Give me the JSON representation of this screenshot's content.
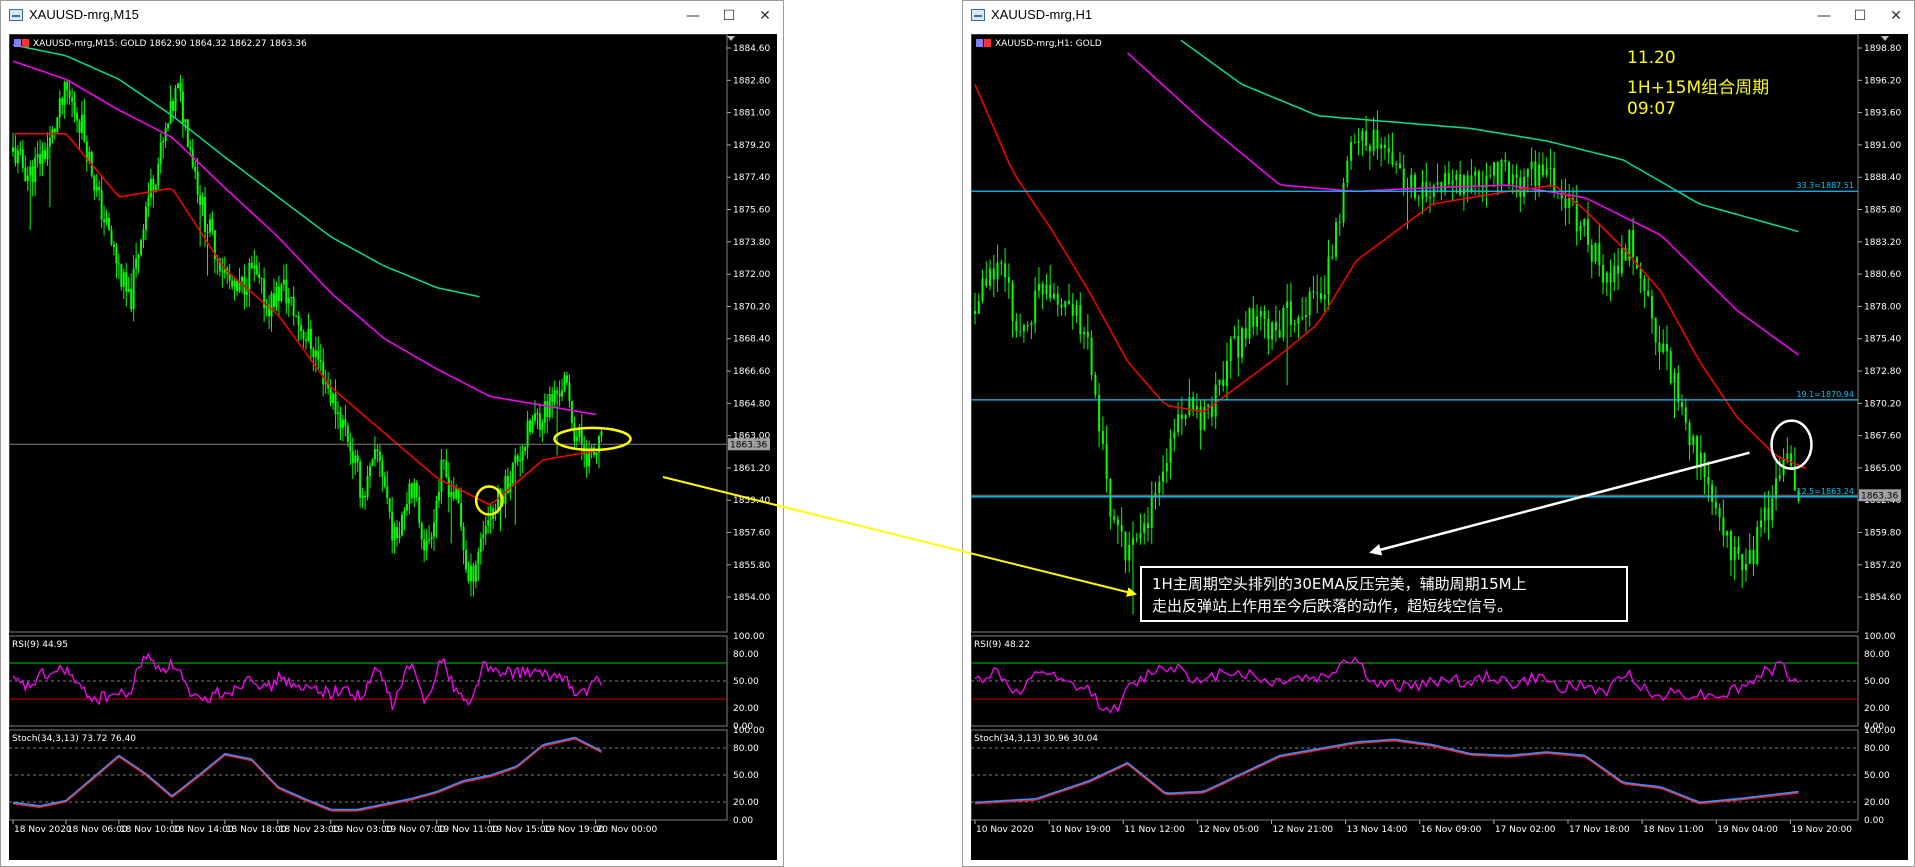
{
  "windows": [
    {
      "id": "m15",
      "title": "XAUUSD-mrg,M15",
      "info_line": "XAUUSD-mrg,M15:  GOLD   1862.90 1864.32 1862.27 1863.36",
      "price_axis": [
        "1884.60",
        "1882.80",
        "1881.00",
        "1879.20",
        "1877.40",
        "1875.60",
        "1873.80",
        "1872.00",
        "1870.20",
        "1868.40",
        "1866.60",
        "1864.80",
        "1863.00",
        "1861.20",
        "1859.40",
        "1857.60",
        "1855.80",
        "1854.00"
      ],
      "current_price": "1863.36",
      "rsi_label": "RSI(9) 44.95",
      "rsi_axis": [
        "100.00",
        "80.00",
        "50.00",
        "20.00",
        "0.00"
      ],
      "stoch_label": "Stoch(34,3,13) 73.72 76.40",
      "stoch_axis": [
        "100.00",
        "80.00",
        "50.00",
        "20.00",
        "0.00"
      ],
      "time_axis": [
        "18 Nov 2020",
        "18 Nov 06:00",
        "18 Nov 10:00",
        "18 Nov 14:00",
        "18 Nov 18:00",
        "18 Nov 23:00",
        "19 Nov 03:00",
        "19 Nov 07:00",
        "19 Nov 11:00",
        "19 Nov 15:00",
        "19 Nov 19:00",
        "20 Nov 00:00"
      ]
    },
    {
      "id": "h1",
      "title": "XAUUSD-mrg,H1",
      "info_line": "XAUUSD-mrg,H1:  GOLD",
      "price_axis": [
        "1898.80",
        "1896.20",
        "1893.60",
        "1891.00",
        "1888.40",
        "1885.80",
        "1883.20",
        "1880.60",
        "1878.00",
        "1875.40",
        "1872.80",
        "1870.20",
        "1867.60",
        "1865.00",
        "1862.40",
        "1859.80",
        "1857.20",
        "1854.60"
      ],
      "current_price": "1863.36",
      "rsi_label": "RSI(9) 48.22",
      "rsi_axis": [
        "100.00",
        "80.00",
        "50.00",
        "20.00",
        "0.00"
      ],
      "stoch_label": "Stoch(34,3,13) 30.96 30.04",
      "stoch_axis": [
        "100.00",
        "80.00",
        "50.00",
        "20.00",
        "0.00"
      ],
      "time_axis": [
        "10 Nov 2020",
        "10 Nov 19:00",
        "11 Nov 12:00",
        "12 Nov 05:00",
        "12 Nov 21:00",
        "13 Nov 14:00",
        "16 Nov 09:00",
        "17 Nov 02:00",
        "17 Nov 18:00",
        "18 Nov 11:00",
        "19 Nov 04:00",
        "19 Nov 20:00"
      ],
      "fib_levels": [
        {
          "label": "33.3=1887.51",
          "price": 1887.51
        },
        {
          "label": "19.1=1870.94",
          "price": 1870.94
        },
        {
          "label": "12.5=1863.24",
          "price": 1863.24
        }
      ]
    }
  ],
  "annotation": {
    "date": "11.20",
    "subtitle": "1H+15M组合周期",
    "time": "09:07",
    "text_line1": "1H主周期空头排列的30EMA反压完美，辅助周期15M上",
    "text_line2": "走出反弹站上作用至今后跌落的动作，超短线空信号。"
  },
  "window_buttons": {
    "minimize": "—",
    "maximize": "☐",
    "close": "✕"
  },
  "colors": {
    "candle": "#00ff00",
    "ema30": "#ff0000",
    "ema_mid": "#ff00ff",
    "ema_long": "#00e08a",
    "fib": "#00c8ff",
    "rsi": "#ff00ff",
    "stoch_main": "#ff2020",
    "stoch_signal": "#3b8cff",
    "annotation_text": "#ffff00",
    "arrow_yellow": "#ffff00",
    "arrow_white": "#ffffff"
  },
  "chart_data": [
    {
      "type": "candlestick",
      "title": "XAUUSD-mrg,M15",
      "ylim": [
        1853.0,
        1886.0
      ],
      "x": [
        "18 Nov 2020",
        "18 Nov 06:00",
        "18 Nov 10:00",
        "18 Nov 14:00",
        "18 Nov 18:00",
        "18 Nov 23:00",
        "19 Nov 03:00",
        "19 Nov 07:00",
        "19 Nov 11:00",
        "19 Nov 15:00",
        "19 Nov 19:00",
        "20 Nov 00:00"
      ],
      "close_path": [
        [
          0,
          1879.5
        ],
        [
          0.3,
          1878.2
        ],
        [
          0.7,
          1880.0
        ],
        [
          1.0,
          1882.8
        ],
        [
          1.3,
          1881.0
        ],
        [
          1.6,
          1877.0
        ],
        [
          1.9,
          1874.0
        ],
        [
          2.2,
          1871.0
        ],
        [
          2.5,
          1876.5
        ],
        [
          2.8,
          1879.5
        ],
        [
          3.1,
          1883.0
        ],
        [
          3.3,
          1880.5
        ],
        [
          3.6,
          1876.0
        ],
        [
          3.9,
          1873.5
        ],
        [
          4.2,
          1871.5
        ],
        [
          4.5,
          1873.0
        ],
        [
          4.8,
          1871.0
        ],
        [
          5.1,
          1872.0
        ],
        [
          5.4,
          1870.0
        ],
        [
          5.7,
          1868.5
        ],
        [
          6.0,
          1866.0
        ],
        [
          6.3,
          1864.0
        ],
        [
          6.6,
          1860.5
        ],
        [
          6.9,
          1863.0
        ],
        [
          7.2,
          1858.0
        ],
        [
          7.5,
          1861.5
        ],
        [
          7.8,
          1857.5
        ],
        [
          8.1,
          1862.0
        ],
        [
          8.4,
          1860.0
        ],
        [
          8.6,
          1855.5
        ],
        [
          8.9,
          1859.0
        ],
        [
          9.2,
          1860.5
        ],
        [
          9.5,
          1862.5
        ],
        [
          9.8,
          1864.5
        ],
        [
          10.1,
          1865.5
        ],
        [
          10.4,
          1866.8
        ],
        [
          10.6,
          1864.0
        ],
        [
          10.9,
          1862.5
        ],
        [
          11.1,
          1863.4
        ]
      ],
      "ema30": [
        [
          0,
          1880.5
        ],
        [
          1,
          1880.5
        ],
        [
          2,
          1877.0
        ],
        [
          3,
          1877.5
        ],
        [
          4,
          1873.0
        ],
        [
          5,
          1870.5
        ],
        [
          6,
          1866.5
        ],
        [
          7,
          1864.0
        ],
        [
          8,
          1861.5
        ],
        [
          9,
          1860.0
        ],
        [
          10,
          1862.5
        ],
        [
          11,
          1863.0
        ]
      ],
      "ema_mid": [
        [
          0,
          1884.5
        ],
        [
          1,
          1883.5
        ],
        [
          2,
          1881.8
        ],
        [
          3,
          1880.3
        ],
        [
          4,
          1877.5
        ],
        [
          5,
          1874.8
        ],
        [
          6,
          1871.7
        ],
        [
          7,
          1869.2
        ],
        [
          8,
          1867.5
        ],
        [
          9,
          1866.0
        ],
        [
          10,
          1865.5
        ],
        [
          11,
          1865.0
        ]
      ],
      "ema_long": [
        [
          0,
          1885.4
        ],
        [
          1,
          1884.8
        ],
        [
          2,
          1883.5
        ],
        [
          3,
          1881.5
        ],
        [
          4,
          1879.2
        ],
        [
          5,
          1877.0
        ],
        [
          6,
          1874.8
        ],
        [
          7,
          1873.2
        ],
        [
          8,
          1872.0
        ],
        [
          8.8,
          1871.5
        ]
      ],
      "rsi": {
        "ylim": [
          0,
          100
        ],
        "levels": [
          70,
          50,
          30
        ],
        "last": 44.95
      },
      "stoch": {
        "ylim": [
          0,
          100
        ],
        "main_last": 73.72,
        "signal_last": 76.4
      }
    },
    {
      "type": "candlestick",
      "title": "XAUUSD-mrg,H1",
      "ylim": [
        1852.5,
        1900.0
      ],
      "x": [
        "10 Nov 2020",
        "10 Nov 19:00",
        "11 Nov 12:00",
        "12 Nov 05:00",
        "12 Nov 21:00",
        "13 Nov 14:00",
        "16 Nov 09:00",
        "17 Nov 02:00",
        "17 Nov 18:00",
        "18 Nov 11:00",
        "19 Nov 04:00",
        "19 Nov 20:00"
      ],
      "close_path": [
        [
          0,
          1878.0
        ],
        [
          0.3,
          1882.0
        ],
        [
          0.6,
          1876.0
        ],
        [
          0.9,
          1880.5
        ],
        [
          1.2,
          1879.0
        ],
        [
          1.5,
          1875.0
        ],
        [
          1.8,
          1860.5
        ],
        [
          2.1,
          1858.5
        ],
        [
          2.4,
          1864.0
        ],
        [
          2.7,
          1870.5
        ],
        [
          3.0,
          1869.0
        ],
        [
          3.3,
          1874.0
        ],
        [
          3.6,
          1877.0
        ],
        [
          3.9,
          1876.5
        ],
        [
          4.2,
          1878.0
        ],
        [
          4.6,
          1880.0
        ],
        [
          5.0,
          1893.0
        ],
        [
          5.3,
          1891.0
        ],
        [
          5.6,
          1889.0
        ],
        [
          5.9,
          1887.0
        ],
        [
          6.2,
          1888.5
        ],
        [
          6.5,
          1887.5
        ],
        [
          6.8,
          1889.5
        ],
        [
          7.1,
          1888.0
        ],
        [
          7.4,
          1889.5
        ],
        [
          7.7,
          1887.0
        ],
        [
          8.0,
          1884.5
        ],
        [
          8.3,
          1880.0
        ],
        [
          8.6,
          1883.5
        ],
        [
          8.9,
          1877.0
        ],
        [
          9.2,
          1872.0
        ],
        [
          9.5,
          1866.0
        ],
        [
          9.8,
          1860.0
        ],
        [
          10.1,
          1857.5
        ],
        [
          10.4,
          1862.0
        ],
        [
          10.6,
          1866.5
        ],
        [
          10.8,
          1863.4
        ]
      ],
      "ema30": [
        [
          0,
          1896.0
        ],
        [
          0.5,
          1889.0
        ],
        [
          1,
          1884.5
        ],
        [
          1.5,
          1879.5
        ],
        [
          2,
          1874.0
        ],
        [
          2.5,
          1870.5
        ],
        [
          3,
          1870.0
        ],
        [
          4,
          1874.5
        ],
        [
          4.5,
          1877.0
        ],
        [
          5,
          1882.0
        ],
        [
          6,
          1886.5
        ],
        [
          7,
          1887.5
        ],
        [
          7.6,
          1888.0
        ],
        [
          8,
          1886.0
        ],
        [
          8.5,
          1883.0
        ],
        [
          9,
          1879.5
        ],
        [
          9.5,
          1874.0
        ],
        [
          10,
          1869.5
        ],
        [
          10.5,
          1866.5
        ],
        [
          10.9,
          1865.5
        ]
      ],
      "ema_mid": [
        [
          2,
          1898.5
        ],
        [
          3,
          1893.0
        ],
        [
          3.5,
          1890.5
        ],
        [
          4,
          1888.0
        ],
        [
          5,
          1887.5
        ],
        [
          6,
          1887.8
        ],
        [
          7,
          1888.0
        ],
        [
          8,
          1887.0
        ],
        [
          9,
          1884.0
        ],
        [
          10,
          1878.0
        ],
        [
          10.8,
          1874.5
        ]
      ],
      "ema_long": [
        [
          2.7,
          1899.5
        ],
        [
          3.5,
          1896.0
        ],
        [
          4.5,
          1893.5
        ],
        [
          5.5,
          1893.0
        ],
        [
          6.5,
          1892.5
        ],
        [
          7.5,
          1891.5
        ],
        [
          8.5,
          1890.0
        ],
        [
          9.5,
          1886.5
        ],
        [
          10.8,
          1884.3
        ]
      ],
      "fib": [
        1887.51,
        1870.94,
        1863.24
      ],
      "rsi": {
        "ylim": [
          0,
          100
        ],
        "levels": [
          70,
          50,
          30
        ],
        "last": 48.22
      },
      "stoch": {
        "ylim": [
          0,
          100
        ],
        "main_last": 30.96,
        "signal_last": 30.04
      }
    }
  ]
}
